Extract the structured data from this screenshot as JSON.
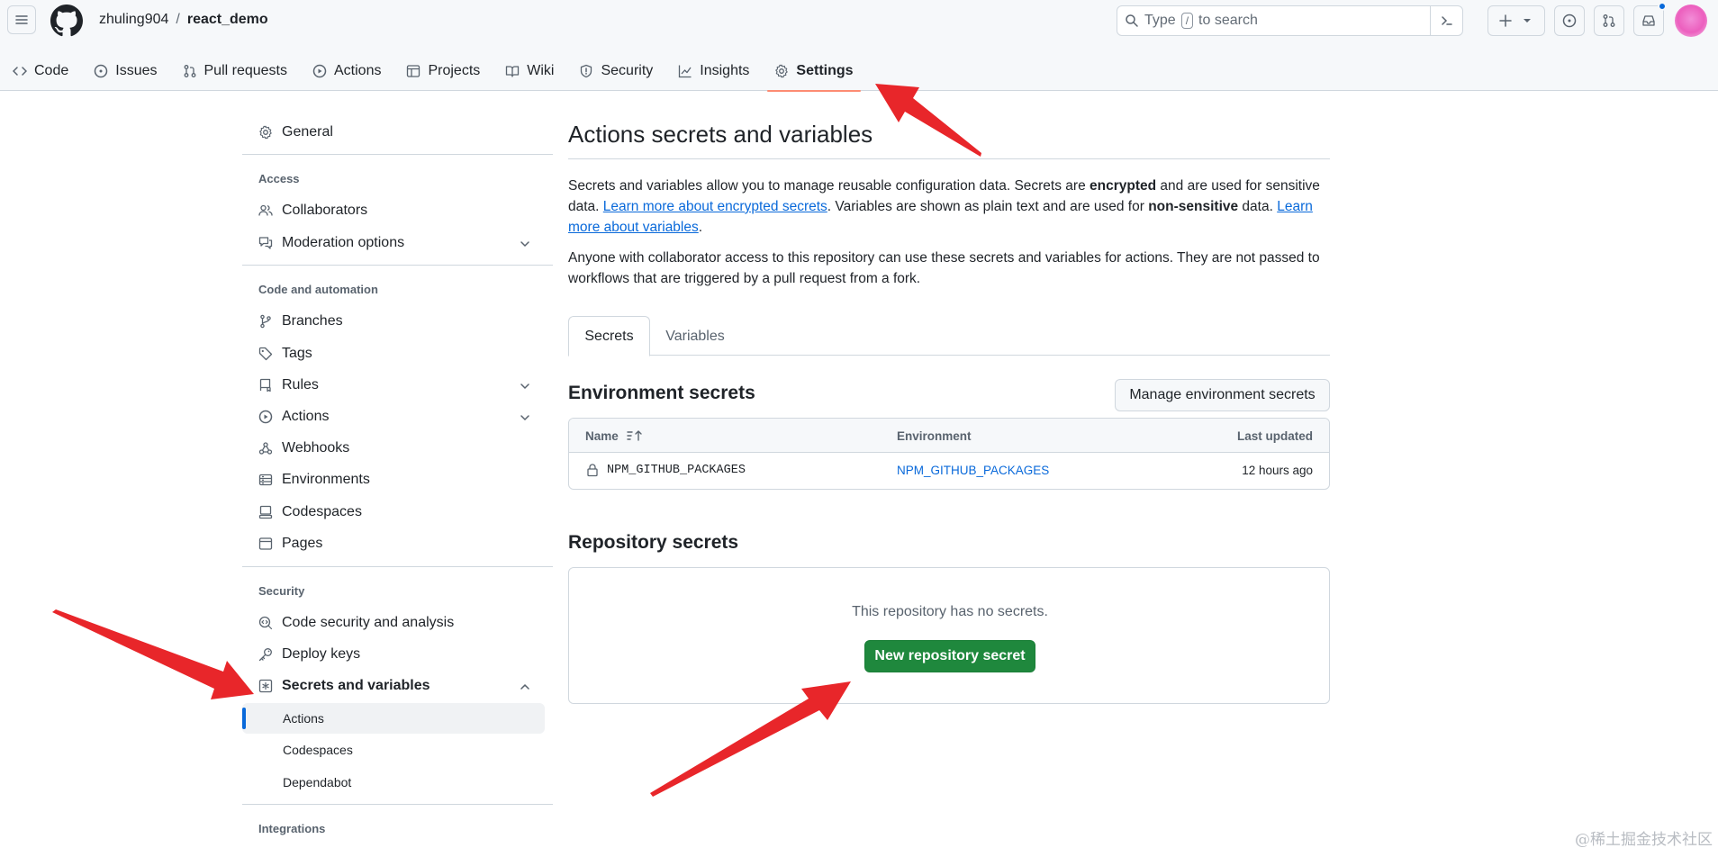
{
  "header": {
    "owner": "zhuling904",
    "separator": "/",
    "repo": "react_demo",
    "search_prefix": "Type",
    "search_key": "/",
    "search_suffix": "to search"
  },
  "repo_nav": [
    {
      "label": "Code",
      "icon": "code-icon"
    },
    {
      "label": "Issues",
      "icon": "issue-icon"
    },
    {
      "label": "Pull requests",
      "icon": "pull-request-icon"
    },
    {
      "label": "Actions",
      "icon": "play-icon"
    },
    {
      "label": "Projects",
      "icon": "table-icon"
    },
    {
      "label": "Wiki",
      "icon": "book-icon"
    },
    {
      "label": "Security",
      "icon": "shield-icon"
    },
    {
      "label": "Insights",
      "icon": "graph-icon"
    },
    {
      "label": "Settings",
      "icon": "gear-icon",
      "active": true
    }
  ],
  "sidebar": {
    "general": "General",
    "access_heading": "Access",
    "collaborators": "Collaborators",
    "moderation": "Moderation options",
    "code_heading": "Code and automation",
    "branches": "Branches",
    "tags": "Tags",
    "rules": "Rules",
    "actions": "Actions",
    "webhooks": "Webhooks",
    "environments": "Environments",
    "codespaces": "Codespaces",
    "pages": "Pages",
    "security_heading": "Security",
    "code_security": "Code security and analysis",
    "deploy_keys": "Deploy keys",
    "secrets_variables": "Secrets and variables",
    "sub_actions": "Actions",
    "sub_codespaces": "Codespaces",
    "sub_dependabot": "Dependabot",
    "integrations_heading": "Integrations"
  },
  "main": {
    "title": "Actions secrets and variables",
    "p1_a": "Secrets and variables allow you to manage reusable configuration data. Secrets are ",
    "p1_b": "encrypted",
    "p1_c": " and are used for sensitive data. ",
    "p1_link1": "Learn more about encrypted secrets",
    "p1_d": ". Variables are shown as plain text and are used for ",
    "p1_e": "non-sensitive",
    "p1_f": " data. ",
    "p1_link2": "Learn more about variables",
    "p1_g": ".",
    "p2": "Anyone with collaborator access to this repository can use these secrets and variables for actions. They are not passed to workflows that are triggered by a pull request from a fork.",
    "tab_secrets": "Secrets",
    "tab_variables": "Variables",
    "env_title": "Environment secrets",
    "manage_button": "Manage environment secrets",
    "col_name": "Name",
    "col_environment": "Environment",
    "col_updated": "Last updated",
    "rows": [
      {
        "name": "NPM_GITHUB_PACKAGES",
        "environment": "NPM_GITHUB_PACKAGES",
        "updated": "12 hours ago"
      }
    ],
    "repo_title": "Repository secrets",
    "empty_text": "This repository has no secrets.",
    "new_button": "New repository secret"
  },
  "watermark": "@稀土掘金技术社区",
  "colors": {
    "accent_blue": "#0969da",
    "primary_green": "#1f883d",
    "nav_underline": "#fd8c73",
    "annotation_arrow": "#e8262a"
  }
}
